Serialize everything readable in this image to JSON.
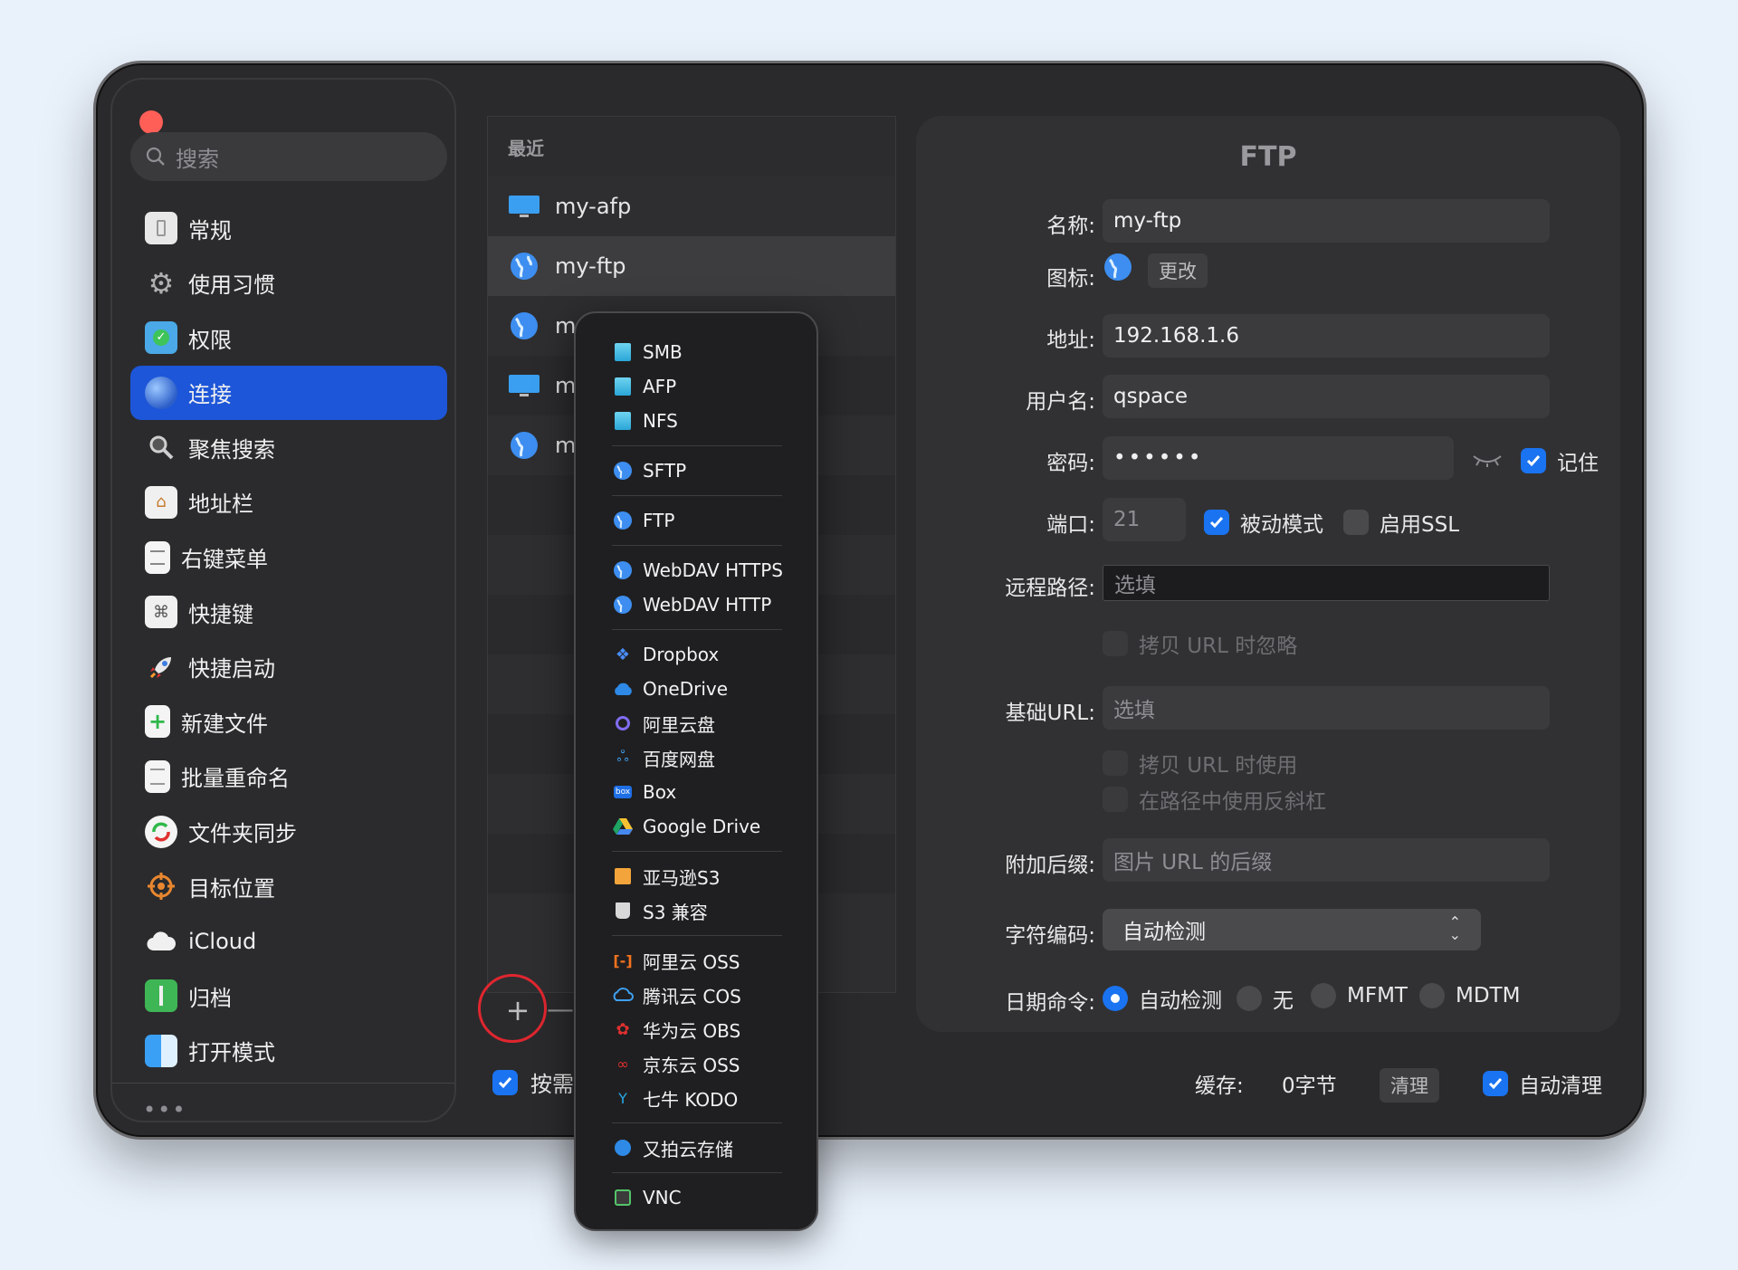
{
  "search": {
    "placeholder": "搜索"
  },
  "sidebar": {
    "items": [
      {
        "label": "常规",
        "icon": "switch-icon"
      },
      {
        "label": "使用习惯",
        "icon": "gear-icon"
      },
      {
        "label": "权限",
        "icon": "folder-check-icon"
      },
      {
        "label": "连接",
        "icon": "globe-icon"
      },
      {
        "label": "聚焦搜索",
        "icon": "magnifier-icon"
      },
      {
        "label": "地址栏",
        "icon": "home-bar-icon"
      },
      {
        "label": "右键菜单",
        "icon": "menu-doc-icon"
      },
      {
        "label": "快捷键",
        "icon": "command-key-icon"
      },
      {
        "label": "快捷启动",
        "icon": "rocket-icon"
      },
      {
        "label": "新建文件",
        "icon": "new-file-icon"
      },
      {
        "label": "批量重命名",
        "icon": "list-doc-icon"
      },
      {
        "label": "文件夹同步",
        "icon": "sync-icon"
      },
      {
        "label": "目标位置",
        "icon": "target-icon"
      },
      {
        "label": "iCloud",
        "icon": "cloud-icon"
      },
      {
        "label": "归档",
        "icon": "archive-icon"
      },
      {
        "label": "打开模式",
        "icon": "finder-icon"
      }
    ],
    "more": "•••"
  },
  "list": {
    "header": "最近",
    "rows": [
      {
        "label": "my-afp",
        "icon": "monitor-icon"
      },
      {
        "label": "my-ftp",
        "icon": "globe-icon"
      },
      {
        "label": "m",
        "icon": "globe-icon"
      },
      {
        "label": "m",
        "icon": "monitor-icon"
      },
      {
        "label": "m",
        "icon": "globe-icon"
      }
    ],
    "plus": "+",
    "minus": "—",
    "on_demand_label": "按需"
  },
  "popup": {
    "groups": [
      [
        {
          "label": "SMB",
          "icon": "drive-icon"
        },
        {
          "label": "AFP",
          "icon": "drive-icon"
        },
        {
          "label": "NFS",
          "icon": "drive-icon"
        }
      ],
      [
        {
          "label": "SFTP",
          "icon": "globe-icon"
        }
      ],
      [
        {
          "label": "FTP",
          "icon": "globe-icon"
        }
      ],
      [
        {
          "label": "WebDAV HTTPS",
          "icon": "globe-icon"
        },
        {
          "label": "WebDAV HTTP",
          "icon": "globe-icon"
        }
      ],
      [
        {
          "label": "Dropbox",
          "icon": "dropbox-icon"
        },
        {
          "label": "OneDrive",
          "icon": "onedrive-icon"
        },
        {
          "label": "阿里云盘",
          "icon": "aliyun-drive-icon"
        },
        {
          "label": "百度网盘",
          "icon": "baidu-icon"
        },
        {
          "label": "Box",
          "icon": "box-icon"
        },
        {
          "label": "Google Drive",
          "icon": "google-drive-icon"
        }
      ],
      [
        {
          "label": "亚马逊S3",
          "icon": "amazon-box-icon"
        },
        {
          "label": "S3 兼容",
          "icon": "bucket-icon"
        }
      ],
      [
        {
          "label": "阿里云 OSS",
          "icon": "aliyun-oss-icon"
        },
        {
          "label": "腾讯云 COS",
          "icon": "tencent-icon"
        },
        {
          "label": "华为云 OBS",
          "icon": "huawei-icon"
        },
        {
          "label": "京东云 OSS",
          "icon": "jd-icon"
        },
        {
          "label": "七牛 KODO",
          "icon": "qiniu-icon"
        }
      ],
      [
        {
          "label": "又拍云存储",
          "icon": "upyun-icon"
        }
      ],
      [
        {
          "label": "VNC",
          "icon": "vnc-icon"
        }
      ]
    ]
  },
  "form": {
    "title": "FTP",
    "name_label": "名称:",
    "name_value": "my-ftp",
    "icon_label": "图标:",
    "change_label": "更改",
    "address_label": "地址:",
    "address_value": "192.168.1.6",
    "user_label": "用户名:",
    "user_value": "qspace",
    "password_label": "密码:",
    "password_value": "••••••",
    "remember_label": "记住",
    "port_label": "端口:",
    "port_value": "21",
    "passive_label": "被动模式",
    "ssl_label": "启用SSL",
    "remote_path_label": "远程路径:",
    "remote_path_placeholder": "选填",
    "ignore_copy_label": "拷贝 URL 时忽略",
    "base_url_label": "基础URL:",
    "base_url_placeholder": "选填",
    "use_copy_label": "拷贝 URL 时使用",
    "backslash_label": "在路径中使用反斜杠",
    "suffix_label": "附加后缀:",
    "suffix_placeholder": "图片 URL 的后缀",
    "encoding_label": "字符编码:",
    "encoding_value": "自动检测",
    "date_label": "日期命令:",
    "date_options": [
      "自动检测",
      "无",
      "MFMT",
      "MDTM"
    ]
  },
  "footer": {
    "cache_label": "缓存:",
    "cache_value": "0字节",
    "clear_label": "清理",
    "auto_clear_label": "自动清理"
  },
  "colors": {
    "accent": "#1a73f0",
    "sidebar_active": "#1d56d8",
    "highlight_ring": "#e0262f"
  }
}
